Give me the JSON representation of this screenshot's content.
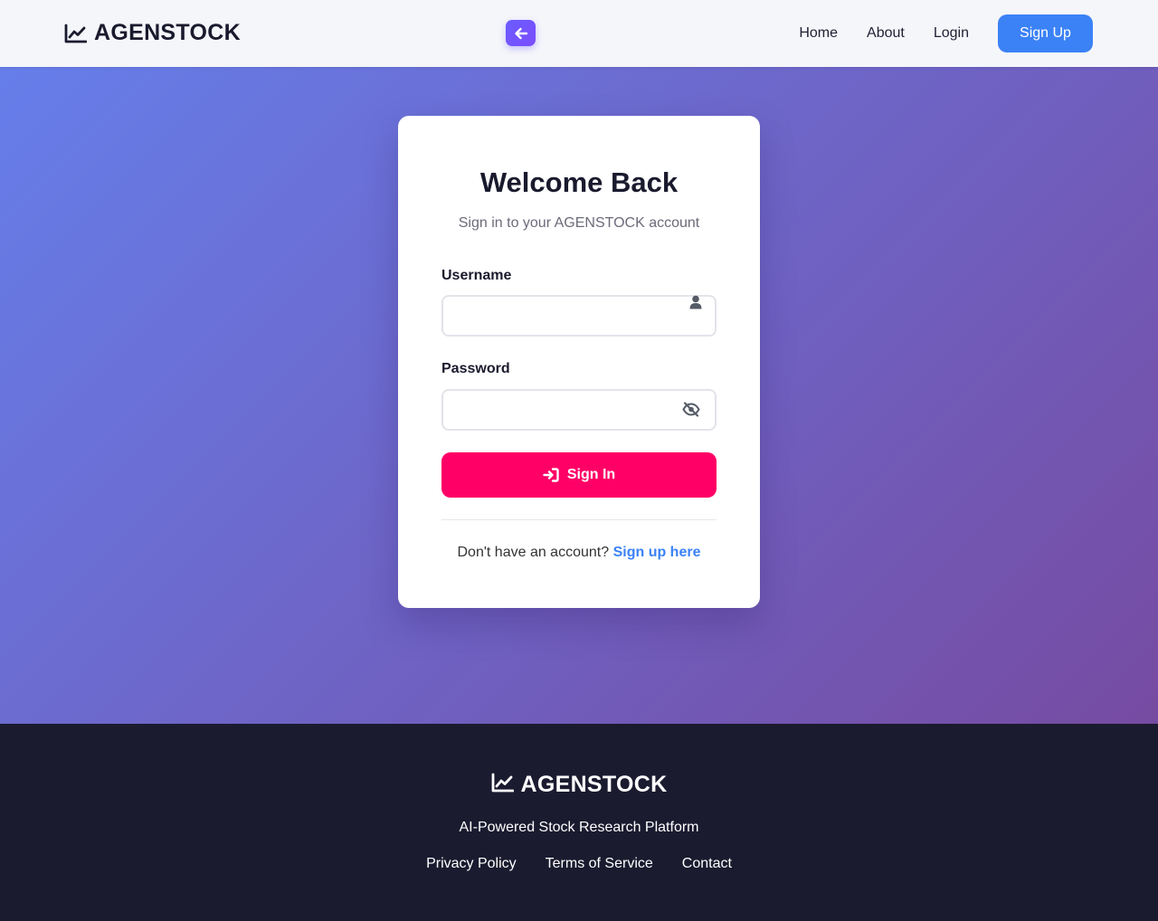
{
  "nav": {
    "brand": "AGENSTOCK",
    "links": [
      "Home",
      "About",
      "Login"
    ],
    "signup_label": "Sign Up"
  },
  "login": {
    "title": "Welcome Back",
    "subtitle": "Sign in to your AGENSTOCK account",
    "username_label": "Username",
    "username_value": "",
    "password_label": "Password",
    "password_value": "",
    "submit_label": "Sign In",
    "no_account_text": "Don't have an account?",
    "signup_link": "Sign up here"
  },
  "footer": {
    "brand": "AGENSTOCK",
    "tagline": "AI-Powered Stock Research Platform",
    "links": [
      "Privacy Policy",
      "Terms of Service",
      "Contact"
    ]
  },
  "colors": {
    "nav_bg": "#f5f6fa",
    "hero_gradient_start": "#667eea",
    "hero_gradient_end": "#764ba2",
    "primary_blue": "#3b82f6",
    "signin_pink": "#ff0066",
    "footer_bg": "#1b1b30"
  },
  "icons": {
    "brand": "chart-line-icon",
    "back": "arrow-left-icon",
    "username": "user-icon",
    "password": "eye-slash-icon",
    "signin": "sign-in-icon"
  }
}
